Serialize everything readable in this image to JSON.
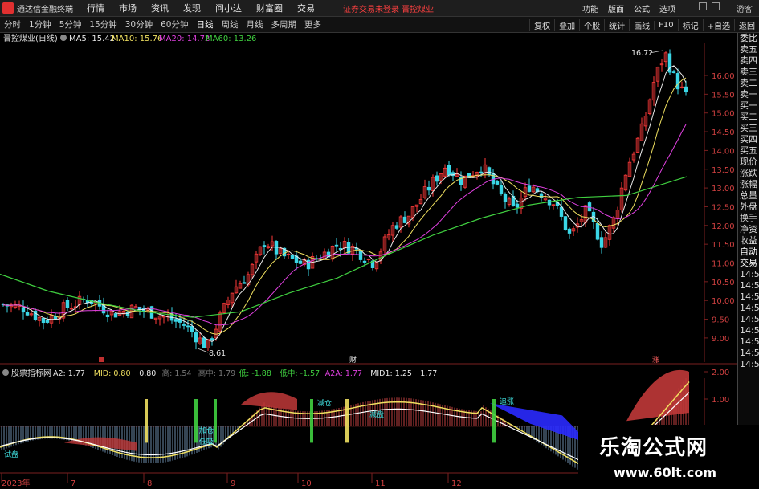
{
  "app": {
    "title": "通达信金融终端",
    "menu": [
      "行情",
      "市场",
      "资讯",
      "发现",
      "问小达",
      "财富圈",
      "交易"
    ],
    "alert": "证券交易未登录 晋控煤业",
    "top_right": [
      "功能",
      "版面",
      "公式",
      "选项"
    ],
    "guest": "游客"
  },
  "periods": [
    "分时",
    "1分钟",
    "5分钟",
    "15分钟",
    "30分钟",
    "60分钟",
    "日线",
    "周线",
    "月线",
    "多周期",
    "更多"
  ],
  "active_period": "日线",
  "right_tools": [
    "复权",
    "叠加",
    "个股",
    "统计",
    "画线",
    "F10",
    "标记",
    "+自选",
    "返回"
  ],
  "main_chart": {
    "stock": "晋控煤业(日线)",
    "ma": [
      {
        "label": "MA5: 15.42",
        "color": "#e8e8e8"
      },
      {
        "label": "MA10: 15.76",
        "color": "#f0e060"
      },
      {
        "label": "MA20: 14.72",
        "color": "#e040e0"
      },
      {
        "label": "MA60: 13.26",
        "color": "#40d040"
      }
    ],
    "high_label": "16.72",
    "low_label": "8.61",
    "markers": [
      "财",
      "涨"
    ],
    "y_ticks": [
      "16.00",
      "15.50",
      "15.00",
      "14.50",
      "14.00",
      "13.50",
      "13.00",
      "12.50",
      "12.00",
      "11.50",
      "11.00",
      "10.50",
      "10.00",
      "9.50",
      "9.00"
    ]
  },
  "indicator": {
    "name": "股票指标网",
    "values": [
      {
        "label": "A2: 1.77",
        "color": "#e8e8e8"
      },
      {
        "label": "MID: 0.80",
        "color": "#f0e060"
      },
      {
        "label": "0.80",
        "color": "#e8e8e8"
      },
      {
        "label": "高: 1.54",
        "color": "#777777"
      },
      {
        "label": "高中: 1.79",
        "color": "#777777"
      },
      {
        "label": "低: -1.88",
        "color": "#40d040"
      },
      {
        "label": "低中: -1.57",
        "color": "#40d040"
      },
      {
        "label": "A2A: 1.77",
        "color": "#e040e0"
      },
      {
        "label": "MID1: 1.25",
        "color": "#e8e8e8"
      },
      {
        "label": "1.77",
        "color": "#e8e8e8"
      }
    ],
    "y_ticks": [
      "2.00",
      "1.00"
    ],
    "annotations": [
      "减仓",
      "试盘",
      "加仓",
      "低吸",
      "追涨",
      "减盘"
    ]
  },
  "x_axis": [
    "2023年",
    "7",
    "8",
    "9",
    "10",
    "11",
    "12"
  ],
  "right_panel": [
    "委比",
    "卖五",
    "卖四",
    "卖三",
    "卖二",
    "卖一",
    "买一",
    "买二",
    "买三",
    "买四",
    "买五",
    "现价",
    "涨跌",
    "涨幅",
    "总量",
    "外盘",
    "换手",
    "净资",
    "收益",
    "自动",
    "交易",
    "14:5",
    "14:5",
    "14:5",
    "14:5",
    "14:5",
    "14:5",
    "14:5",
    "14:5",
    "14:5"
  ],
  "watermark": {
    "cn": "乐淘公式网",
    "url": "www.60lt.com"
  }
}
